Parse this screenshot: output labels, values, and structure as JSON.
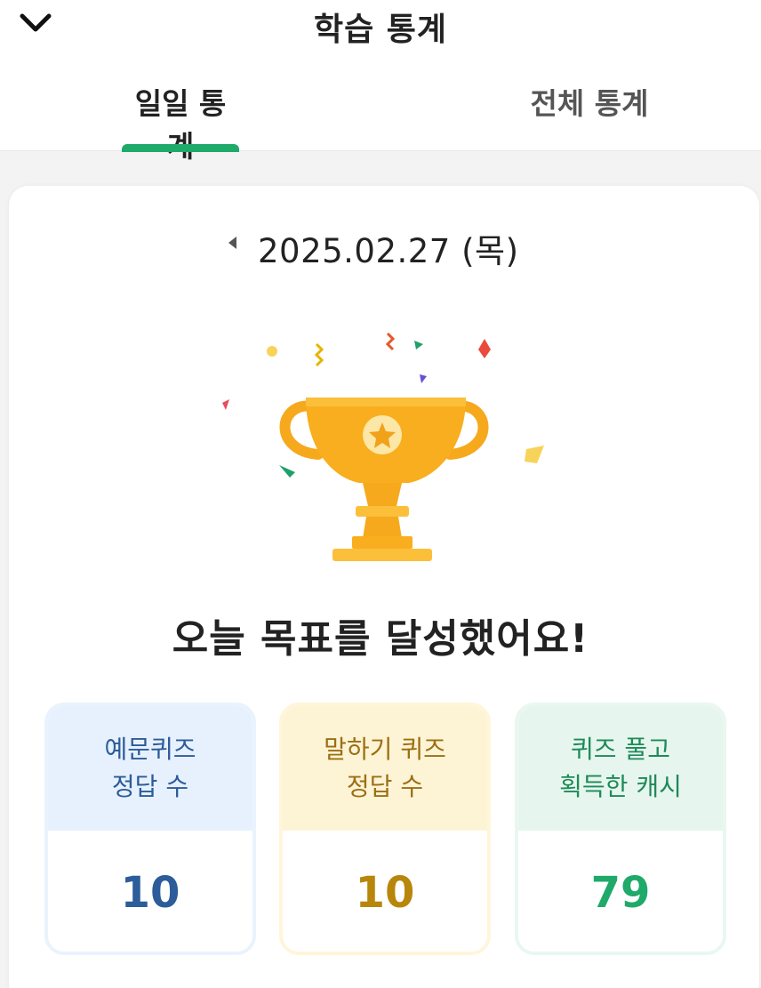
{
  "header": {
    "title": "학습 통계",
    "back_icon": "chevron-down-icon"
  },
  "tabs": [
    {
      "label": "일일 통계",
      "active": true
    },
    {
      "label": "전체 통계",
      "active": false
    }
  ],
  "date_nav": {
    "date": "2025.02.27 (목)",
    "prev_icon": "caret-left-icon"
  },
  "hero": {
    "icon": "trophy-icon",
    "message": "오늘 목표를 달성했어요!"
  },
  "stats": [
    {
      "line1": "예문퀴즈",
      "line2": "정답 수",
      "value": "10",
      "color": "#2c5c99"
    },
    {
      "line1": "말하기 퀴즈",
      "line2": "정답 수",
      "value": "10",
      "color": "#b8860b"
    },
    {
      "line1": "퀴즈 풀고",
      "line2": "획득한 캐시",
      "value": "79",
      "color": "#1faa6a"
    }
  ],
  "colors": {
    "accent": "#1faa6a",
    "trophy": "#f6a91c"
  }
}
